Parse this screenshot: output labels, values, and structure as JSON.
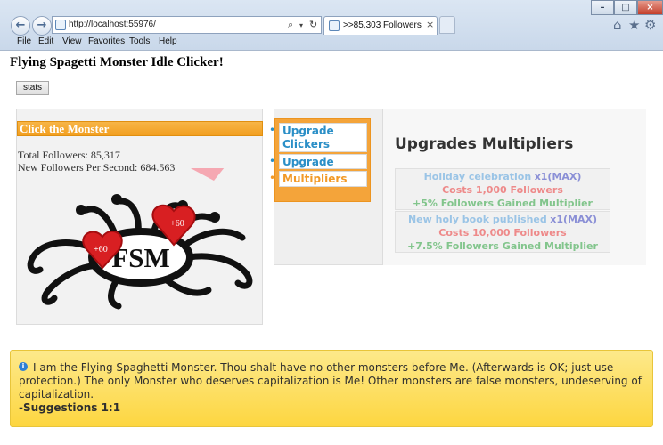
{
  "browser": {
    "url": "http://localhost:55976/",
    "tab_title": ">>85,303 Followers",
    "tab_close": "×",
    "back_icon": "←",
    "forward_icon": "→",
    "search_icon": "⌕",
    "dropdown_icon": "▾",
    "refresh_icon": "↻",
    "window_minimize": "–",
    "window_maximize": "□",
    "window_close": "×",
    "home_icon": "⌂",
    "star_icon": "★",
    "gear_icon": "⚙",
    "menu": [
      "File",
      "Edit",
      "View",
      "Favorites",
      "Tools",
      "Help"
    ]
  },
  "page": {
    "title": "Flying Spagetti Monster Idle Clicker!",
    "stats_button": "stats"
  },
  "click_panel": {
    "header": "Click the Monster",
    "total_followers": "Total Followers: 85,317",
    "new_followers": "New Followers Per Second: 684.563",
    "monster_text": "FSM",
    "heart_labels": [
      "+60",
      "+60"
    ]
  },
  "upgrade_tabs": [
    {
      "label": "Upgrade Clickers",
      "bullet": "•"
    },
    {
      "label": "Upgrade Autos",
      "bullet": "•"
    },
    {
      "label": "Multipliers",
      "bullet": "•"
    }
  ],
  "multipliers": {
    "title": "Upgrades Multipliers",
    "items": [
      {
        "name": "Holiday celebration",
        "multiplier": "x1(MAX)",
        "cost": "Costs 1,000 Followers",
        "gain": "+5% Followers Gained Multiplier"
      },
      {
        "name": "New holy book published",
        "multiplier": "x1(MAX)",
        "cost": "Costs 10,000 Followers",
        "gain": "+7.5% Followers Gained Multiplier"
      }
    ]
  },
  "alert": {
    "icon": "i",
    "message": "I am the Flying Spaghetti Monster. Thou shalt have no other monsters before Me. (Afterwards is OK; just use protection.) The only Monster who deserves capitalization is Me! Other monsters are false monsters, undeserving of capitalization.",
    "suggestion": "-Suggestions 1:1"
  },
  "colors": {
    "accent_orange": "#f29f20",
    "alert_yellow": "#fdd640",
    "tab_blue": "#2b8fc7",
    "cost_red": "#ee8a8a",
    "gain_green": "#82c58c",
    "heart_red": "#d81f22"
  }
}
